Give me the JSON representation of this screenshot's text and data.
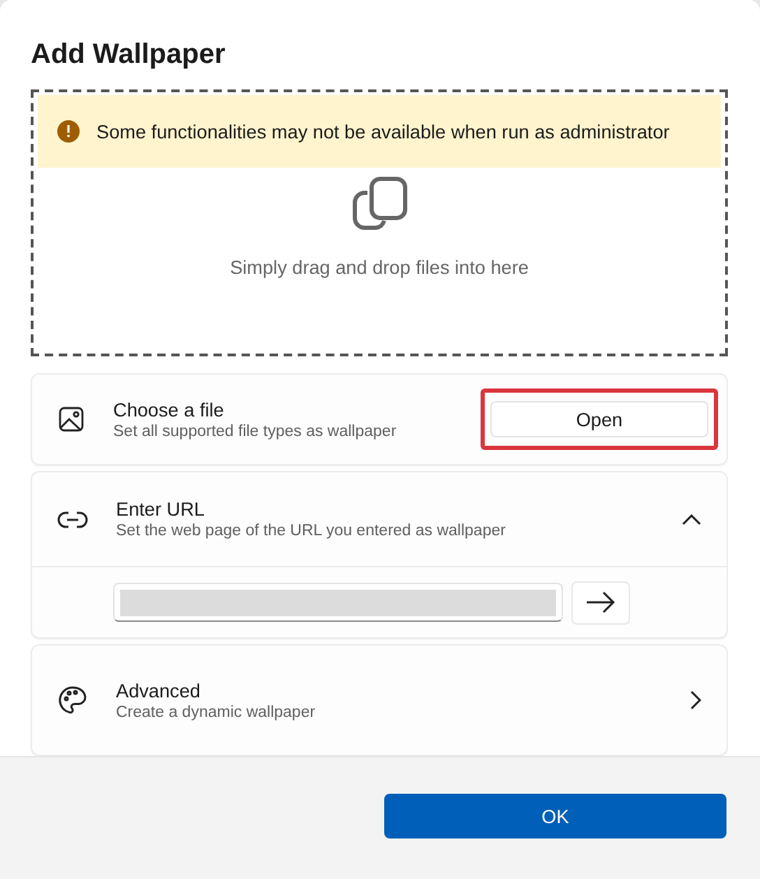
{
  "dialog": {
    "title": "Add Wallpaper"
  },
  "drop_zone": {
    "warning": "Some functionalities may not be available when run as administrator",
    "hint": "Simply drag and drop files into here"
  },
  "settings": [
    {
      "kind": "button",
      "title": "Choose a file",
      "description": "Set all supported file types as wallpaper",
      "button": "Open",
      "highlighted": true
    },
    {
      "kind": "expander",
      "title": "Enter URL",
      "description": "Set the web page of the URL you entered as wallpaper",
      "expanded": true
    },
    {
      "kind": "link",
      "title": "Advanced",
      "description": "Create a dynamic wallpaper"
    }
  ],
  "footer": {
    "buttons": [
      "OK"
    ]
  }
}
